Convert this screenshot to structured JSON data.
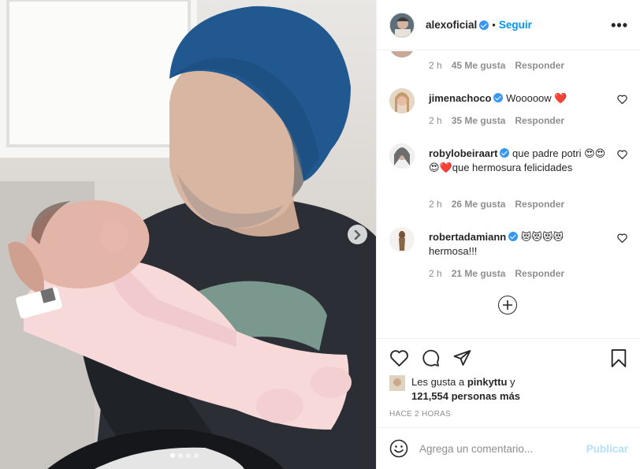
{
  "colors": {
    "accent": "#0095f6",
    "verified": "#3897f0",
    "muted": "#8e8e8e",
    "heart_red": "#c41e3a"
  },
  "header": {
    "username": "alexoficial",
    "separator": "•",
    "follow_label": "Seguir",
    "more_label": "•••"
  },
  "comments": {
    "partial": {
      "time": "2 h",
      "likes": "45 Me gusta",
      "reply": "Responder"
    },
    "items": [
      {
        "username": "jimenachoco",
        "text": "Wooooow ❤️",
        "time": "2 h",
        "likes": "35 Me gusta",
        "reply": "Responder"
      },
      {
        "username": "robylobeiraart",
        "text": "que padre potri 😍😍😍❤️que hermosura felicidades",
        "time": "2 h",
        "likes": "26 Me gusta",
        "reply": "Responder"
      },
      {
        "username": "robertadamiann",
        "text": "😻😻😻😻 hermosa!!!",
        "time": "2 h",
        "likes": "21 Me gusta",
        "reply": "Responder"
      }
    ]
  },
  "likes": {
    "prefix": "Les gusta a",
    "user": "pinkyttu",
    "suffix": "y",
    "count": "121,554 personas más"
  },
  "time_ago": "HACE 2 HORAS",
  "add_comment": {
    "placeholder": "Agrega un comentario...",
    "publish_label": "Publicar"
  },
  "carousel": {
    "slides": 4,
    "active_index": 0
  },
  "icons": {
    "next": "chevron-right-icon",
    "like": "heart-icon",
    "comment": "comment-icon",
    "share": "paper-plane-icon",
    "save": "bookmark-icon",
    "emoji": "emoji-icon",
    "load_more": "plus-circle-icon"
  }
}
